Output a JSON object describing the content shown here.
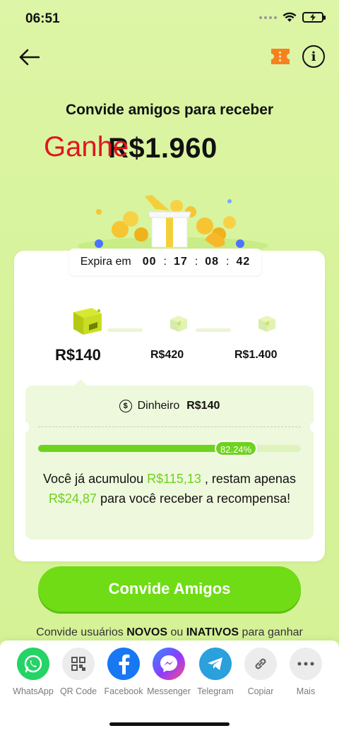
{
  "status_bar": {
    "time": "06:51"
  },
  "header": {
    "back_icon": "arrow-left-icon",
    "ticket_icon": "ticket-icon",
    "info_icon": "info-icon",
    "info_glyph": "i"
  },
  "hero": {
    "headline": "Convide amigos para receber",
    "amount": "R$1.960",
    "overlay_text": "Ganhe",
    "overlay_color": "#e3141f"
  },
  "timer": {
    "label": "Expira em",
    "hours": "00",
    "minutes": "17",
    "seconds": "08",
    "centis": "42",
    "sep": ":"
  },
  "milestones": [
    {
      "label": "R$140",
      "icon": "gift-box-open-icon",
      "active": true
    },
    {
      "label": "R$420",
      "icon": "gift-box-icon",
      "active": false
    },
    {
      "label": "R$1.400",
      "icon": "gift-box-icon",
      "active": false
    }
  ],
  "reward": {
    "cash_label": "Dinheiro",
    "cash_amount": "R$140",
    "progress_percent": 82.24,
    "progress_text": "82.24%",
    "msg_part1": "Você já acumulou ",
    "accumulated": "R$115,13",
    "msg_part2": " , restam apenas ",
    "remaining": "R$24,87",
    "msg_part3": " para você receber a recompensa!"
  },
  "cta": {
    "label": "Convide Amigos"
  },
  "subnote": {
    "part1": "Convide usuários ",
    "bold1": "NOVOS",
    "part2": " ou ",
    "bold2": "INATIVOS",
    "part3": " para ganhar"
  },
  "share": [
    {
      "name": "WhatsApp",
      "icon": "whatsapp-icon",
      "color": "#25d366"
    },
    {
      "name": "QR Code",
      "icon": "qr-code-icon",
      "color": "#ececec"
    },
    {
      "name": "Facebook",
      "icon": "facebook-icon",
      "color": "#1877f2"
    },
    {
      "name": "Messenger",
      "icon": "messenger-icon",
      "color": "#8f3bff"
    },
    {
      "name": "Telegram",
      "icon": "telegram-icon",
      "color": "#2aa0dc"
    },
    {
      "name": "Copiar",
      "icon": "link-icon",
      "color": "#ececec"
    },
    {
      "name": "Mais",
      "icon": "more-icon",
      "color": "#ececec"
    }
  ],
  "colors": {
    "accent_green": "#6ed21e",
    "background": "#d7f39b"
  }
}
